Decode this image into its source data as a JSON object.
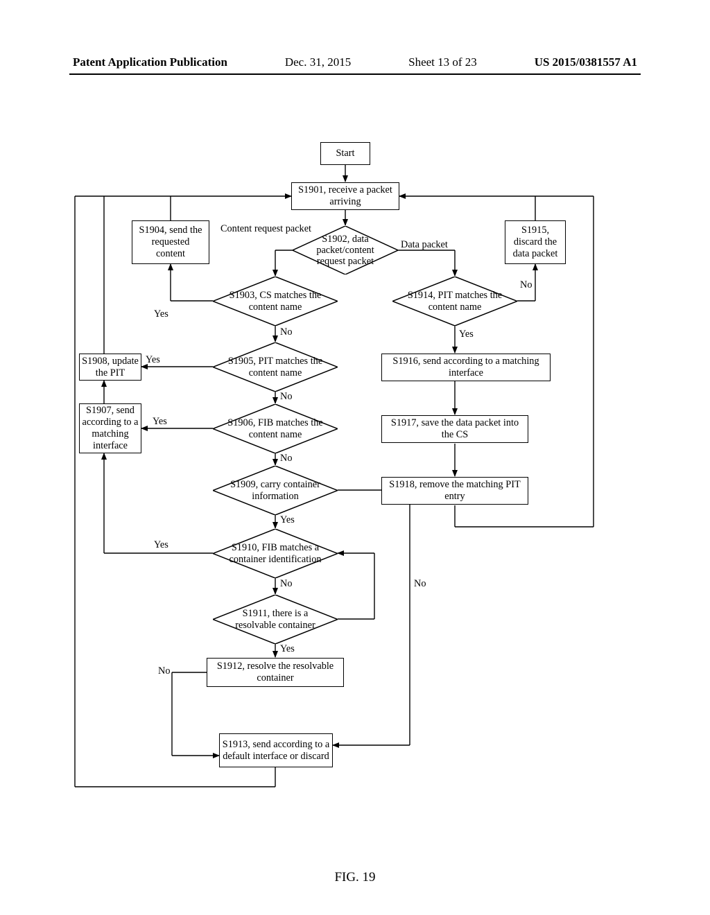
{
  "header": {
    "title": "Patent Application Publication",
    "date": "Dec. 31, 2015",
    "sheet": "Sheet 13 of 23",
    "pubno": "US 2015/0381557 A1"
  },
  "figure_label": "FIG. 19",
  "boxes": {
    "start": "Start",
    "s1901": "S1901, receive a packet arriving",
    "s1904": "S1904, send the requested content",
    "s1915": "S1915, discard the data packet",
    "s1908": "S1908, update the PIT",
    "s1916": "S1916, send according to  a matching interface",
    "s1907": "S1907, send according to a matching interface",
    "s1917": "S1917, save the data packet into the CS",
    "s1918": "S1918, remove the matching PIT entry",
    "s1912": "S1912, resolve the resolvable container",
    "s1913": "S1913, send according to a default interface or discard"
  },
  "diamonds": {
    "s1902": "S1902, data packet/content request packet",
    "s1903": "S1903, CS matches the content name",
    "s1914": "S1914, PIT matches the content name",
    "s1905": "S1905, PIT matches the content name",
    "s1906": "S1906, FIB matches the content name",
    "s1909": "S1909, carry container information",
    "s1910": "S1910, FIB matches a container identification",
    "s1911": "S1911, there is a resolvable container"
  },
  "labels": {
    "content_req": "Content request packet",
    "data_packet": "Data packet",
    "yes": "Yes",
    "no": "No"
  }
}
